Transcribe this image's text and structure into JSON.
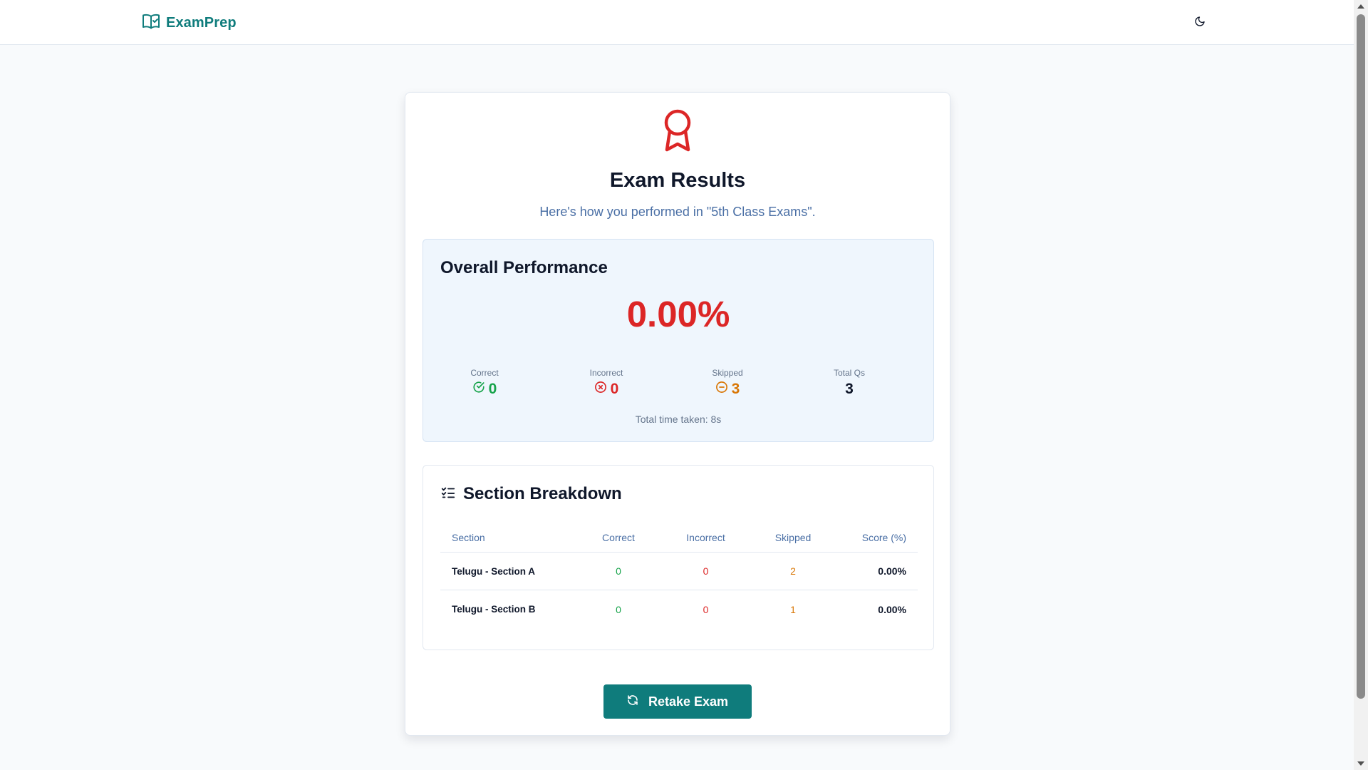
{
  "header": {
    "brand": "ExamPrep",
    "theme_icon": "moon-icon",
    "logo_icon": "book-check-icon"
  },
  "results": {
    "title": "Exam Results",
    "subtitle": "Here's how you performed in \"5th Class Exams\".",
    "icon": "award-icon"
  },
  "overall": {
    "title": "Overall Performance",
    "score": "0.00%",
    "stats": {
      "correct": {
        "label": "Correct",
        "value": "0",
        "icon": "check-circle-icon",
        "color": "#16a34a"
      },
      "incorrect": {
        "label": "Incorrect",
        "value": "0",
        "icon": "x-circle-icon",
        "color": "#dc2626"
      },
      "skipped": {
        "label": "Skipped",
        "value": "3",
        "icon": "minus-circle-icon",
        "color": "#d97706"
      },
      "total": {
        "label": "Total Qs",
        "value": "3"
      }
    },
    "time_taken": "Total time taken: 8s"
  },
  "breakdown": {
    "title": "Section Breakdown",
    "icon": "list-checks-icon",
    "columns": [
      "Section",
      "Correct",
      "Incorrect",
      "Skipped",
      "Score (%)"
    ],
    "rows": [
      {
        "section": "Telugu - Section A",
        "correct": "0",
        "incorrect": "0",
        "skipped": "2",
        "score": "0.00%"
      },
      {
        "section": "Telugu - Section B",
        "correct": "0",
        "incorrect": "0",
        "skipped": "1",
        "score": "0.00%"
      }
    ]
  },
  "actions": {
    "retake_label": "Retake Exam",
    "retake_icon": "refresh-icon"
  },
  "colors": {
    "accent": "#0f7c7c",
    "danger": "#dc2626",
    "success": "#16a34a",
    "warning": "#d97706"
  }
}
